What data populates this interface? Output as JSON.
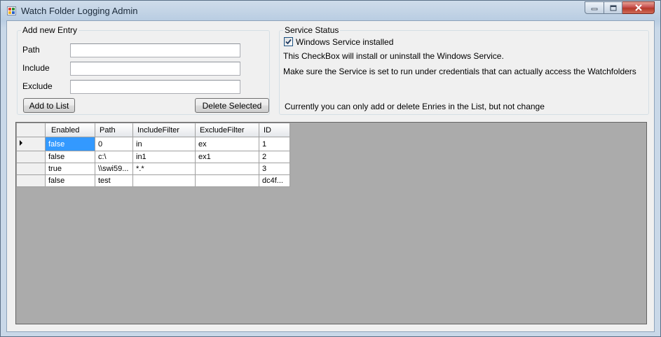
{
  "window": {
    "title": "Watch Folder Logging Admin",
    "icon": "app-icon",
    "controls": [
      "minimize-icon",
      "maximize-icon",
      "close-icon"
    ]
  },
  "add_entry": {
    "group_title": "Add new Entry",
    "path_label": "Path",
    "include_label": "Include",
    "exclude_label": "Exclude",
    "path_value": "",
    "include_value": "",
    "exclude_value": "",
    "add_button": "Add to List",
    "delete_button": "Delete Selected"
  },
  "service_status": {
    "group_title": "Service Status",
    "checkbox_label": "Windows Service installed",
    "checkbox_checked": true,
    "info_line1": "This CheckBox will install or uninstall the Windows Service.",
    "info_line2": "Make sure the Service is set to run under credentials that can actually access the Watchfolders",
    "info_line3": "Currently you can only add or delete Enries in the List, but not change"
  },
  "grid": {
    "columns": [
      "Enabled",
      "Path",
      "IncludeFilter",
      "ExcludeFilter",
      "ID"
    ],
    "rows": [
      {
        "enabled": "false",
        "path": "0",
        "include": "in",
        "exclude": "ex",
        "id": "1",
        "current": true
      },
      {
        "enabled": "false",
        "path": "c:\\",
        "include": "in1",
        "exclude": "ex1",
        "id": "2"
      },
      {
        "enabled": "true",
        "path": "\\\\swi59...",
        "include": "*.*",
        "exclude": "",
        "id": "3"
      },
      {
        "enabled": "false",
        "path": "test",
        "include": "",
        "exclude": "",
        "id": "dc4f..."
      }
    ]
  },
  "colors": {
    "selection": "#3399ff",
    "grid_background": "#ababab",
    "form_background": "#f0f0f0"
  }
}
